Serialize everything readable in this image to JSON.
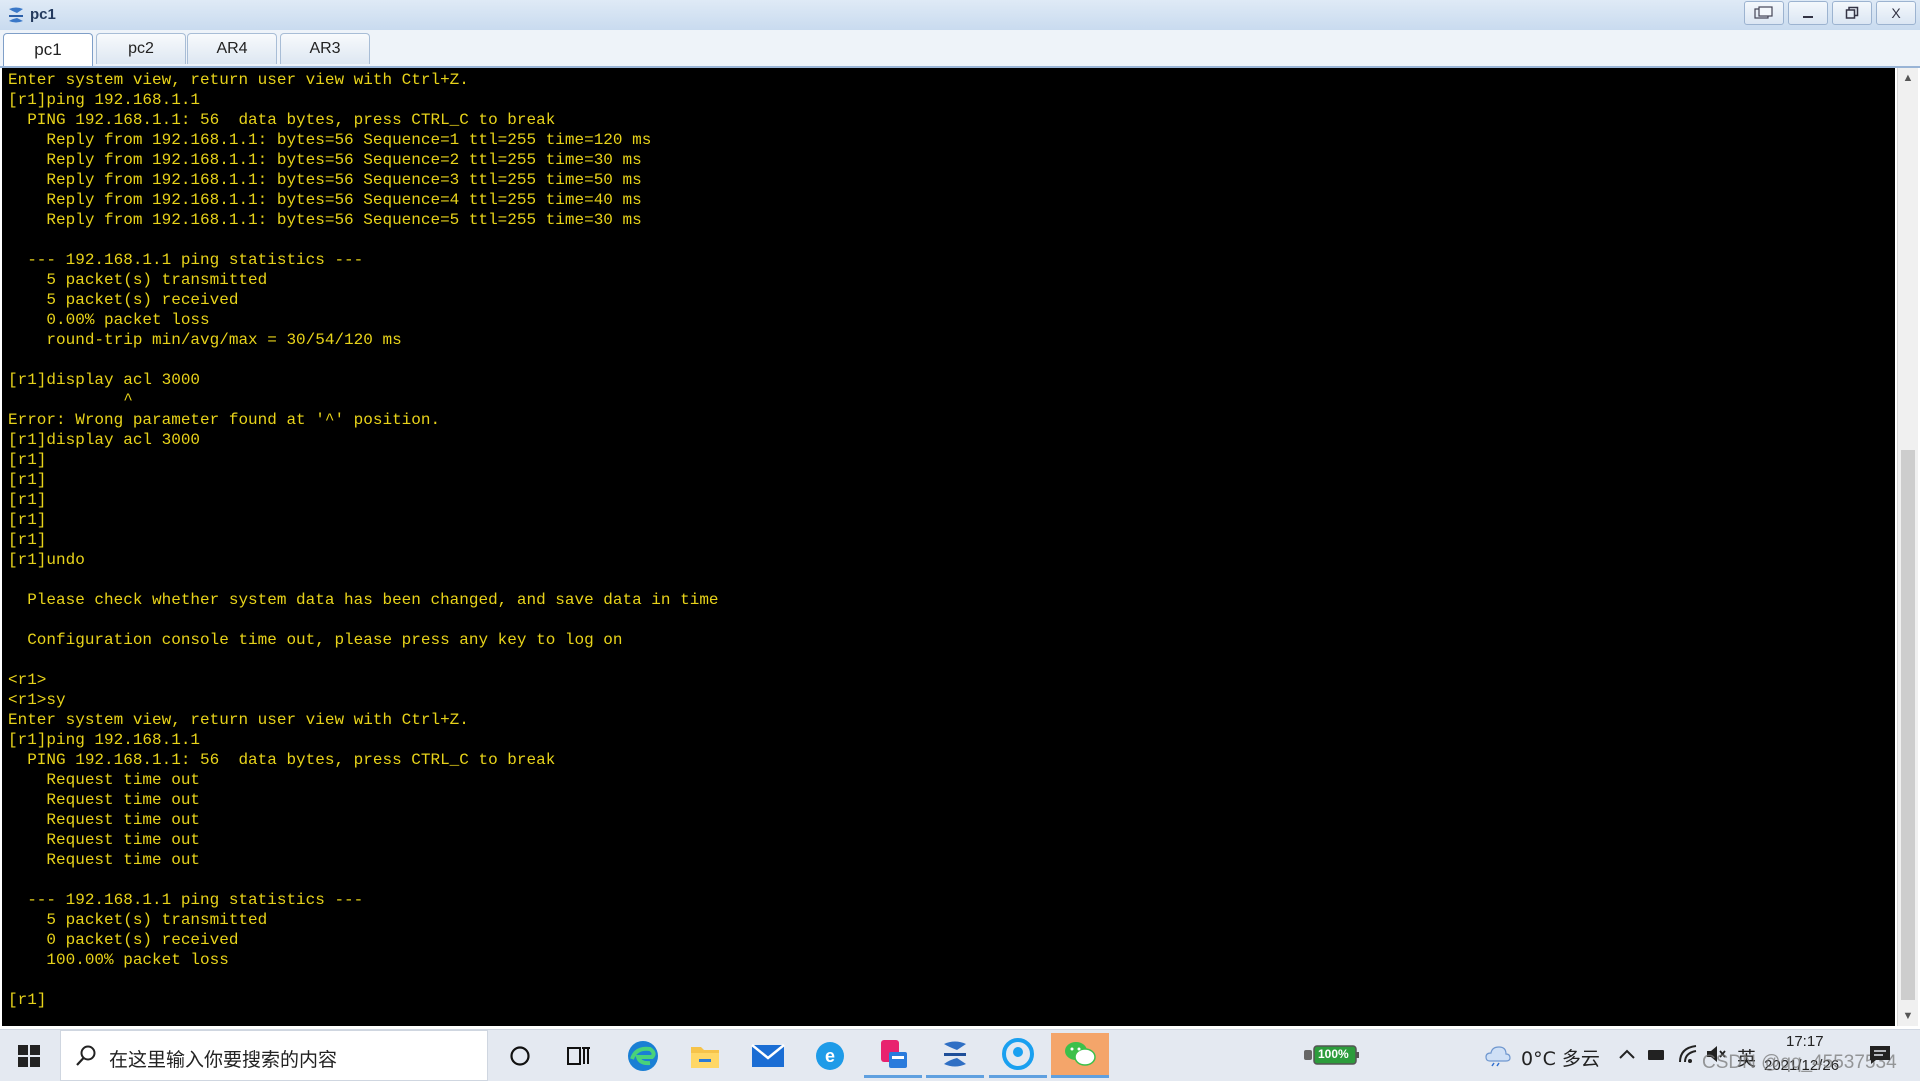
{
  "window": {
    "title": "pc1",
    "controls": [
      "restore-console-icon",
      "minimize-icon",
      "maximize-icon",
      "close-icon"
    ],
    "close_label": "X"
  },
  "tabs": [
    {
      "label": "pc1",
      "active": true
    },
    {
      "label": "pc2",
      "active": false
    },
    {
      "label": "AR4",
      "active": false
    },
    {
      "label": "AR3",
      "active": false
    }
  ],
  "terminal": {
    "text_color": "#e8d31a",
    "background": "#000000",
    "lines": [
      "Enter system view, return user view with Ctrl+Z.",
      "[r1]ping 192.168.1.1",
      "  PING 192.168.1.1: 56  data bytes, press CTRL_C to break",
      "    Reply from 192.168.1.1: bytes=56 Sequence=1 ttl=255 time=120 ms",
      "    Reply from 192.168.1.1: bytes=56 Sequence=2 ttl=255 time=30 ms",
      "    Reply from 192.168.1.1: bytes=56 Sequence=3 ttl=255 time=50 ms",
      "    Reply from 192.168.1.1: bytes=56 Sequence=4 ttl=255 time=40 ms",
      "    Reply from 192.168.1.1: bytes=56 Sequence=5 ttl=255 time=30 ms",
      "",
      "  --- 192.168.1.1 ping statistics ---",
      "    5 packet(s) transmitted",
      "    5 packet(s) received",
      "    0.00% packet loss",
      "    round-trip min/avg/max = 30/54/120 ms",
      "",
      "[r1]display acl 3000",
      "            ^",
      "Error: Wrong parameter found at '^' position.",
      "[r1]display acl 3000",
      "[r1]",
      "[r1]",
      "[r1]",
      "[r1]",
      "[r1]",
      "[r1]undo",
      "",
      "  Please check whether system data has been changed, and save data in time",
      "",
      "  Configuration console time out, please press any key to log on",
      "",
      "<r1>",
      "<r1>sy",
      "Enter system view, return user view with Ctrl+Z.",
      "[r1]ping 192.168.1.1",
      "  PING 192.168.1.1: 56  data bytes, press CTRL_C to break",
      "    Request time out",
      "    Request time out",
      "    Request time out",
      "    Request time out",
      "    Request time out",
      "",
      "  --- 192.168.1.1 ping statistics ---",
      "    5 packet(s) transmitted",
      "    0 packet(s) received",
      "    100.00% packet loss",
      "",
      "[r1]"
    ]
  },
  "taskbar": {
    "search_placeholder": "在这里输入你要搜索的内容",
    "apps": [
      "cortana-icon",
      "task-view-icon",
      "edge-icon",
      "file-explorer-icon",
      "mail-icon",
      "ie-icon",
      "app-icon",
      "ensp-icon",
      "qq-browser-icon",
      "wechat-icon"
    ],
    "battery": "100%",
    "weather": "0°C 多云",
    "ime": "英",
    "time": "17:17",
    "date": "2021/12/26",
    "watermark": "CSDN @qq_45537534"
  }
}
